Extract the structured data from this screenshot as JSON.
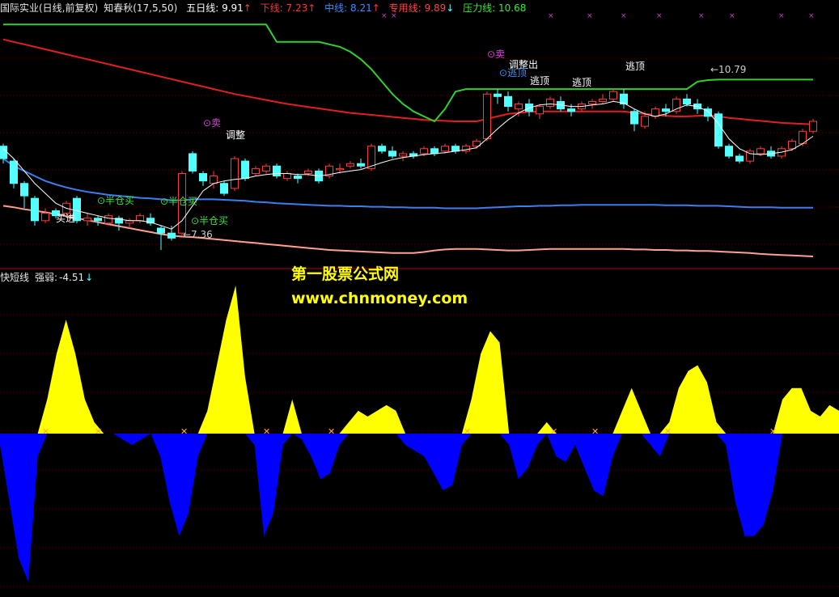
{
  "header": {
    "title": "国际实业(日线,前复权)",
    "indicator": "知春秋(17,5,50)",
    "ma5": {
      "label": "五日线:",
      "value": "9.91",
      "arrow": "↑",
      "color": "#ffffff"
    },
    "lower": {
      "label": "下线:",
      "value": "7.23",
      "arrow": "↑",
      "color": "#ff3333"
    },
    "mid": {
      "label": "中线:",
      "value": "8.21",
      "arrow": "↑",
      "color": "#3a8cff"
    },
    "special": {
      "label": "专用线:",
      "value": "9.89",
      "arrow": "↓",
      "color": "#ff4444"
    },
    "pressure": {
      "label": "压力线:",
      "value": "10.68",
      "color": "#33ee33"
    }
  },
  "sub_header": {
    "title": "快短线",
    "label": "强弱:",
    "value": "-4.51",
    "arrow": "↓"
  },
  "watermark": {
    "line1": "第一股票公式网",
    "line2": "www.chnmoney.com"
  },
  "colors": {
    "up": "#ff3c3c",
    "down": "#54ffff",
    "ma5": "#ffffff",
    "mid": "#3a7ff0",
    "special": "#e02020",
    "pressure": "#2ed12e",
    "support": "#ffa090",
    "pos": "#ffff00",
    "neg": "#0000ff"
  },
  "annotations": [
    {
      "text": "买进",
      "color": "#ffffff"
    },
    {
      "text": "⊙半仓买",
      "color": "#40e040"
    },
    {
      "text": "⊙半仓买",
      "color": "#40e040"
    },
    {
      "text": "⊙半仓买",
      "color": "#40e040"
    },
    {
      "text": "←7.36",
      "color": "#cccccc"
    },
    {
      "text": "⊙卖",
      "color": "#e040e0"
    },
    {
      "text": "调整",
      "color": "#ffffff"
    },
    {
      "text": "⊙卖",
      "color": "#e040e0"
    },
    {
      "text": "调整出",
      "color": "#ffffff"
    },
    {
      "text": "⊙逃顶",
      "color": "#3a8cff"
    },
    {
      "text": "逃顶",
      "color": "#ffffff"
    },
    {
      "text": "逃顶",
      "color": "#ffffff"
    },
    {
      "text": "逃顶",
      "color": "#ffffff"
    },
    {
      "text": "←10.79",
      "color": "#cccccc"
    }
  ],
  "chart_data": [
    {
      "type": "candlestick",
      "candles": [
        {
          "o": 9.45,
          "c": 9.2,
          "h": 9.5,
          "l": 9.1
        },
        {
          "o": 9.15,
          "c": 8.7,
          "h": 9.2,
          "l": 8.6
        },
        {
          "o": 8.7,
          "c": 8.45,
          "h": 8.75,
          "l": 8.2
        },
        {
          "o": 8.4,
          "c": 7.95,
          "h": 8.45,
          "l": 7.85
        },
        {
          "o": 7.95,
          "c": 8.1,
          "h": 8.2,
          "l": 7.9
        },
        {
          "o": 8.15,
          "c": 8.05,
          "h": 8.2,
          "l": 8.0
        },
        {
          "o": 8.1,
          "c": 8.3,
          "h": 8.35,
          "l": 8.05
        },
        {
          "o": 8.4,
          "c": 7.95,
          "h": 8.45,
          "l": 7.9
        },
        {
          "o": 7.95,
          "c": 8.0,
          "h": 8.1,
          "l": 7.85
        },
        {
          "o": 8.0,
          "c": 7.95,
          "h": 8.05,
          "l": 7.85
        },
        {
          "o": 7.9,
          "c": 8.05,
          "h": 8.1,
          "l": 7.85
        },
        {
          "o": 8.0,
          "c": 7.9,
          "h": 8.05,
          "l": 7.75
        },
        {
          "o": 7.9,
          "c": 7.95,
          "h": 8.0,
          "l": 7.8
        },
        {
          "o": 7.95,
          "c": 8.05,
          "h": 8.1,
          "l": 7.9
        },
        {
          "o": 8.0,
          "c": 7.9,
          "h": 8.1,
          "l": 7.85
        },
        {
          "o": 7.8,
          "c": 7.7,
          "h": 7.85,
          "l": 7.36
        },
        {
          "o": 7.7,
          "c": 7.6,
          "h": 7.85,
          "l": 7.55
        },
        {
          "o": 7.7,
          "c": 8.9,
          "h": 8.95,
          "l": 7.65
        },
        {
          "o": 9.3,
          "c": 8.95,
          "h": 9.35,
          "l": 8.9
        },
        {
          "o": 8.9,
          "c": 8.75,
          "h": 8.95,
          "l": 8.65
        },
        {
          "o": 8.7,
          "c": 8.85,
          "h": 8.95,
          "l": 8.6
        },
        {
          "o": 8.7,
          "c": 8.5,
          "h": 8.75,
          "l": 8.45
        },
        {
          "o": 8.6,
          "c": 9.2,
          "h": 9.25,
          "l": 8.55
        },
        {
          "o": 9.15,
          "c": 8.8,
          "h": 9.2,
          "l": 8.75
        },
        {
          "o": 8.9,
          "c": 9.0,
          "h": 9.05,
          "l": 8.85
        },
        {
          "o": 8.95,
          "c": 9.05,
          "h": 9.1,
          "l": 8.9
        },
        {
          "o": 9.05,
          "c": 8.85,
          "h": 9.1,
          "l": 8.8
        },
        {
          "o": 8.8,
          "c": 8.9,
          "h": 8.95,
          "l": 8.75
        },
        {
          "o": 8.85,
          "c": 8.8,
          "h": 8.9,
          "l": 8.7
        },
        {
          "o": 8.9,
          "c": 8.95,
          "h": 9.0,
          "l": 8.85
        },
        {
          "o": 8.95,
          "c": 8.75,
          "h": 9.0,
          "l": 8.7
        },
        {
          "o": 8.85,
          "c": 9.05,
          "h": 9.1,
          "l": 8.8
        },
        {
          "o": 9.0,
          "c": 9.0,
          "h": 9.1,
          "l": 8.9
        },
        {
          "o": 9.05,
          "c": 9.1,
          "h": 9.15,
          "l": 9.0
        },
        {
          "o": 9.1,
          "c": 9.05,
          "h": 9.2,
          "l": 9.0
        },
        {
          "o": 9.0,
          "c": 9.45,
          "h": 9.5,
          "l": 8.95
        },
        {
          "o": 9.45,
          "c": 9.35,
          "h": 9.5,
          "l": 9.3
        },
        {
          "o": 9.35,
          "c": 9.25,
          "h": 9.45,
          "l": 9.2
        },
        {
          "o": 9.25,
          "c": 9.3,
          "h": 9.35,
          "l": 9.15
        },
        {
          "o": 9.3,
          "c": 9.25,
          "h": 9.35,
          "l": 9.2
        },
        {
          "o": 9.3,
          "c": 9.4,
          "h": 9.45,
          "l": 9.25
        },
        {
          "o": 9.4,
          "c": 9.3,
          "h": 9.45,
          "l": 9.25
        },
        {
          "o": 9.35,
          "c": 9.45,
          "h": 9.5,
          "l": 9.3
        },
        {
          "o": 9.45,
          "c": 9.35,
          "h": 9.5,
          "l": 9.3
        },
        {
          "o": 9.35,
          "c": 9.45,
          "h": 9.5,
          "l": 9.3
        },
        {
          "o": 9.45,
          "c": 9.55,
          "h": 9.6,
          "l": 9.4
        },
        {
          "o": 9.6,
          "c": 10.5,
          "h": 10.55,
          "l": 9.55
        },
        {
          "o": 10.5,
          "c": 10.45,
          "h": 10.6,
          "l": 10.3
        },
        {
          "o": 10.45,
          "c": 10.25,
          "h": 10.55,
          "l": 10.15
        },
        {
          "o": 10.2,
          "c": 10.3,
          "h": 10.35,
          "l": 10.05
        },
        {
          "o": 10.3,
          "c": 10.15,
          "h": 10.4,
          "l": 10.05
        },
        {
          "o": 10.1,
          "c": 10.25,
          "h": 10.3,
          "l": 10.0
        },
        {
          "o": 10.25,
          "c": 10.4,
          "h": 10.45,
          "l": 10.2
        },
        {
          "o": 10.35,
          "c": 10.2,
          "h": 10.45,
          "l": 10.15
        },
        {
          "o": 10.2,
          "c": 10.15,
          "h": 10.3,
          "l": 10.05
        },
        {
          "o": 10.2,
          "c": 10.3,
          "h": 10.35,
          "l": 10.15
        },
        {
          "o": 10.3,
          "c": 10.35,
          "h": 10.4,
          "l": 10.2
        },
        {
          "o": 10.35,
          "c": 10.4,
          "h": 10.5,
          "l": 10.3
        },
        {
          "o": 10.4,
          "c": 10.55,
          "h": 10.6,
          "l": 10.35
        },
        {
          "o": 10.5,
          "c": 10.3,
          "h": 10.6,
          "l": 10.2
        },
        {
          "o": 10.15,
          "c": 9.9,
          "h": 10.2,
          "l": 9.75
        },
        {
          "o": 9.85,
          "c": 10.05,
          "h": 10.15,
          "l": 9.8
        },
        {
          "o": 10.05,
          "c": 10.2,
          "h": 10.25,
          "l": 10.0
        },
        {
          "o": 10.2,
          "c": 10.15,
          "h": 10.3,
          "l": 10.05
        },
        {
          "o": 10.15,
          "c": 10.4,
          "h": 10.45,
          "l": 10.1
        },
        {
          "o": 10.4,
          "c": 10.3,
          "h": 10.5,
          "l": 10.25
        },
        {
          "o": 10.3,
          "c": 10.2,
          "h": 10.4,
          "l": 10.1
        },
        {
          "o": 10.2,
          "c": 10.05,
          "h": 10.25,
          "l": 9.95
        },
        {
          "o": 10.1,
          "c": 9.45,
          "h": 10.15,
          "l": 9.4
        },
        {
          "o": 9.45,
          "c": 9.25,
          "h": 9.5,
          "l": 9.2
        },
        {
          "o": 9.25,
          "c": 9.15,
          "h": 9.3,
          "l": 9.1
        },
        {
          "o": 9.15,
          "c": 9.35,
          "h": 9.4,
          "l": 9.1
        },
        {
          "o": 9.3,
          "c": 9.4,
          "h": 9.45,
          "l": 9.25
        },
        {
          "o": 9.35,
          "c": 9.25,
          "h": 9.45,
          "l": 9.2
        },
        {
          "o": 9.25,
          "c": 9.4,
          "h": 9.45,
          "l": 9.2
        },
        {
          "o": 9.4,
          "c": 9.55,
          "h": 9.6,
          "l": 9.35
        },
        {
          "o": 9.5,
          "c": 9.75,
          "h": 9.8,
          "l": 9.45
        },
        {
          "o": 9.75,
          "c": 9.95,
          "h": 10.0,
          "l": 9.7
        }
      ],
      "ma5": [
        9.4,
        9.2,
        8.95,
        8.7,
        8.5,
        8.3,
        8.2,
        8.15,
        8.1,
        8.05,
        8.0,
        7.98,
        7.95,
        7.95,
        7.92,
        7.85,
        7.78,
        7.95,
        8.25,
        8.55,
        8.7,
        8.75,
        8.78,
        8.8,
        8.85,
        8.88,
        8.9,
        8.9,
        8.88,
        8.88,
        8.85,
        8.88,
        8.92,
        8.95,
        8.98,
        9.05,
        9.12,
        9.18,
        9.22,
        9.25,
        9.28,
        9.3,
        9.32,
        9.35,
        9.38,
        9.42,
        9.6,
        9.8,
        9.98,
        10.12,
        10.22,
        10.28,
        10.3,
        10.28,
        10.25,
        10.25,
        10.28,
        10.3,
        10.35,
        10.32,
        10.2,
        10.1,
        10.05,
        10.1,
        10.2,
        10.28,
        10.25,
        10.15,
        9.9,
        9.6,
        9.4,
        9.3,
        9.28,
        9.3,
        9.33,
        9.38,
        9.5,
        9.65
      ],
      "mid_line": [
        9.2,
        9.05,
        8.95,
        8.85,
        8.75,
        8.68,
        8.62,
        8.57,
        8.53,
        8.5,
        8.47,
        8.45,
        8.43,
        8.41,
        8.4,
        8.38,
        8.36,
        8.36,
        8.38,
        8.38,
        8.38,
        8.37,
        8.36,
        8.35,
        8.33,
        8.32,
        8.3,
        8.29,
        8.28,
        8.27,
        8.26,
        8.25,
        8.25,
        8.24,
        8.24,
        8.23,
        8.23,
        8.22,
        8.22,
        8.21,
        8.21,
        8.21,
        8.2,
        8.2,
        8.2,
        8.2,
        8.21,
        8.22,
        8.23,
        8.24,
        8.24,
        8.25,
        8.25,
        8.26,
        8.26,
        8.27,
        8.27,
        8.27,
        8.27,
        8.27,
        8.27,
        8.27,
        8.27,
        8.26,
        8.26,
        8.26,
        8.25,
        8.25,
        8.25,
        8.24,
        8.23,
        8.22,
        8.22,
        8.22,
        8.21,
        8.21,
        8.21,
        8.21
      ],
      "special_line": [
        11.6,
        11.55,
        11.5,
        11.45,
        11.4,
        11.35,
        11.3,
        11.25,
        11.2,
        11.15,
        11.1,
        11.05,
        11.0,
        10.95,
        10.9,
        10.85,
        10.8,
        10.75,
        10.7,
        10.65,
        10.6,
        10.55,
        10.5,
        10.46,
        10.42,
        10.38,
        10.34,
        10.3,
        10.27,
        10.24,
        10.21,
        10.18,
        10.15,
        10.12,
        10.1,
        10.08,
        10.06,
        10.04,
        10.02,
        10.0,
        9.98,
        9.97,
        9.96,
        9.95,
        9.95,
        9.95,
        10.0,
        10.05,
        10.1,
        10.12,
        10.14,
        10.15,
        10.15,
        10.15,
        10.15,
        10.15,
        10.15,
        10.15,
        10.15,
        10.15,
        10.12,
        10.1,
        10.08,
        10.06,
        10.05,
        10.05,
        10.06,
        10.07,
        10.05,
        10.02,
        10.0,
        9.98,
        9.96,
        9.94,
        9.92,
        9.91,
        9.9,
        9.89
      ],
      "pressure_line": [
        11.9,
        11.9,
        11.9,
        11.9,
        11.9,
        11.9,
        11.9,
        11.9,
        11.9,
        11.9,
        11.9,
        11.9,
        11.9,
        11.9,
        11.9,
        11.9,
        11.9,
        11.9,
        11.9,
        11.9,
        11.9,
        11.9,
        11.9,
        11.9,
        11.9,
        11.9,
        11.55,
        11.55,
        11.55,
        11.55,
        11.55,
        11.5,
        11.45,
        11.35,
        11.2,
        11.0,
        10.75,
        10.5,
        10.3,
        10.15,
        10.05,
        9.95,
        10.2,
        10.55,
        10.6,
        10.6,
        10.6,
        10.6,
        10.6,
        10.6,
        10.6,
        10.6,
        10.6,
        10.6,
        10.6,
        10.6,
        10.6,
        10.6,
        10.6,
        10.6,
        10.6,
        10.6,
        10.6,
        10.6,
        10.6,
        10.6,
        10.75,
        10.78,
        10.79,
        10.79,
        10.79,
        10.79,
        10.79,
        10.79,
        10.79,
        10.79,
        10.79,
        10.79
      ],
      "support_line": [
        8.25,
        8.22,
        8.18,
        8.15,
        8.12,
        8.08,
        8.04,
        8.0,
        7.96,
        7.92,
        7.88,
        7.84,
        7.8,
        7.76,
        7.72,
        7.68,
        7.65,
        7.63,
        7.62,
        7.6,
        7.58,
        7.56,
        7.54,
        7.52,
        7.5,
        7.48,
        7.46,
        7.44,
        7.42,
        7.4,
        7.38,
        7.36,
        7.35,
        7.34,
        7.33,
        7.32,
        7.31,
        7.3,
        7.3,
        7.3,
        7.32,
        7.35,
        7.37,
        7.38,
        7.38,
        7.38,
        7.37,
        7.36,
        7.35,
        7.35,
        7.36,
        7.37,
        7.38,
        7.38,
        7.38,
        7.38,
        7.38,
        7.38,
        7.38,
        7.38,
        7.37,
        7.37,
        7.36,
        7.36,
        7.35,
        7.35,
        7.34,
        7.34,
        7.33,
        7.32,
        7.31,
        7.3,
        7.28,
        7.27,
        7.26,
        7.25,
        7.24,
        7.23
      ],
      "ylim": [
        7.1,
        12.1
      ]
    },
    {
      "type": "area",
      "values": [
        -1,
        -6,
        -11,
        -13,
        -2,
        3,
        7,
        10,
        7,
        3,
        1,
        0,
        0,
        -0.5,
        -1,
        -0.5,
        0,
        -2,
        -6,
        -9,
        -7,
        -2,
        2,
        6,
        10,
        13,
        5,
        -1,
        -9,
        -7,
        -1,
        3,
        -0.5,
        -2,
        -4,
        -3.5,
        -1,
        1,
        2,
        1.5,
        2,
        2.5,
        2,
        -1,
        -1.5,
        -2,
        -3.5,
        -5,
        -4.5,
        -1,
        3,
        7,
        9,
        8,
        -1,
        -4,
        -3,
        -1,
        1,
        -2,
        -2.5,
        -1,
        -3,
        -5,
        -5.5,
        -2,
        2,
        4,
        2,
        -1,
        -2,
        1,
        4,
        5.5,
        6,
        4.5,
        1,
        -1,
        -6,
        -9,
        -9,
        -8,
        -5,
        3,
        4,
        4,
        2,
        1.5,
        2.5,
        2
      ],
      "ylim": [
        -14,
        13
      ]
    }
  ]
}
